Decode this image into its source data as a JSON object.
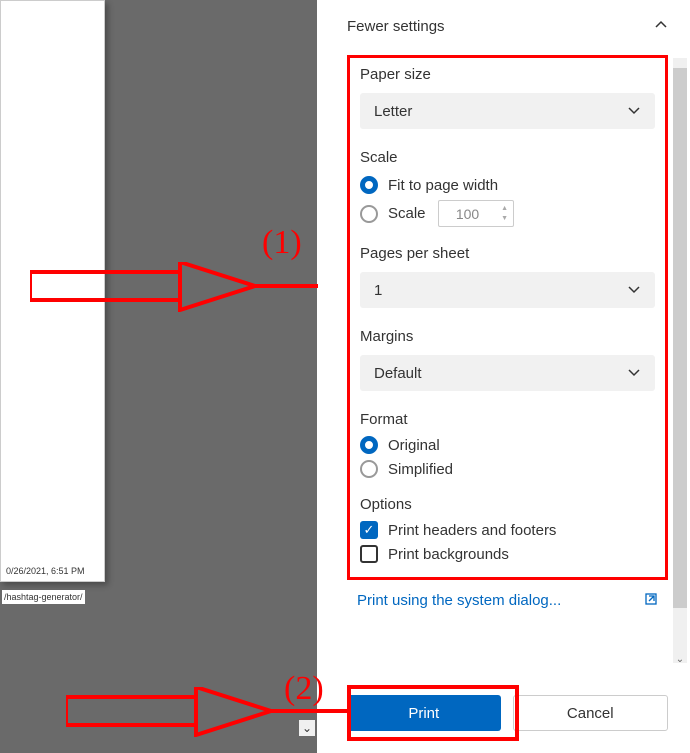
{
  "preview": {
    "timestamp_text": "0/26/2021, 6:51 PM",
    "url_text": "/hashtag-generator/"
  },
  "panel": {
    "fewer_settings_label": "Fewer settings",
    "paper_size": {
      "label": "Paper size",
      "value": "Letter"
    },
    "scale": {
      "label": "Scale",
      "fit_label": "Fit to page width",
      "scale_label": "Scale",
      "scale_value": "100",
      "selected": "fit"
    },
    "pages_per_sheet": {
      "label": "Pages per sheet",
      "value": "1"
    },
    "margins": {
      "label": "Margins",
      "value": "Default"
    },
    "format": {
      "label": "Format",
      "original_label": "Original",
      "simplified_label": "Simplified",
      "selected": "original"
    },
    "options": {
      "label": "Options",
      "headers_footers_label": "Print headers and footers",
      "headers_footers_checked": true,
      "backgrounds_label": "Print backgrounds",
      "backgrounds_checked": false
    },
    "system_dialog_label": "Print using the system dialog...",
    "print_label": "Print",
    "cancel_label": "Cancel"
  },
  "annotations": {
    "label1": "(1)",
    "label2": "(2)"
  }
}
